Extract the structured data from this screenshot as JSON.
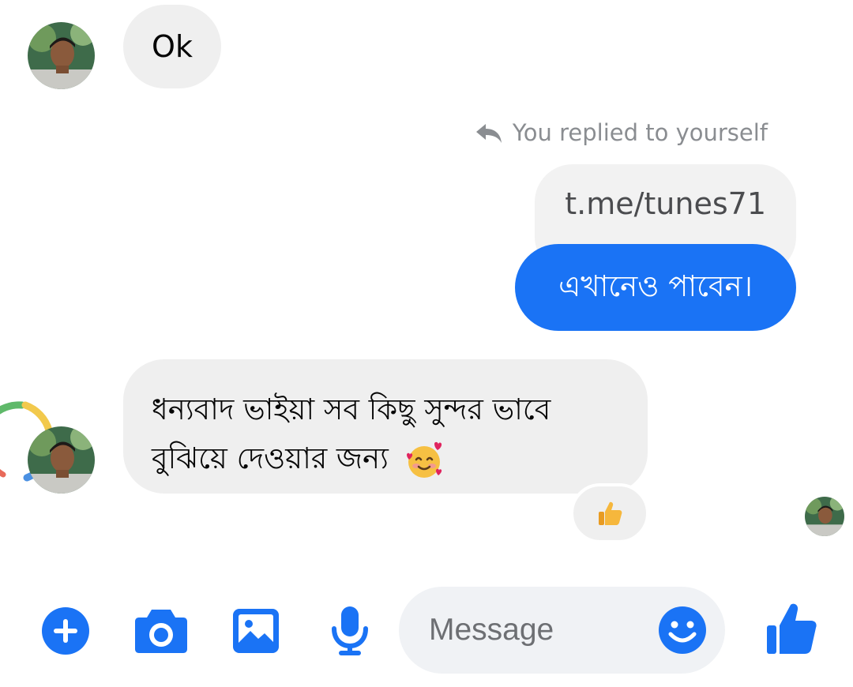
{
  "conversation": {
    "messages": [
      {
        "direction": "incoming",
        "text": "Ok"
      },
      {
        "direction": "outgoing",
        "reply_label": "You replied to yourself",
        "quoted_text": "t.me/tunes71",
        "text": "এখানেও পাবেন।"
      },
      {
        "direction": "incoming",
        "text_line1": "ধন্যবাদ ভাইয়া সব কিছু সুন্দর ভাবে",
        "text_line2": "বুঝিয়ে দেওয়ার জন্য",
        "emoji": "smiling-face-with-hearts",
        "reaction": "thumbs-up"
      }
    ]
  },
  "composer": {
    "placeholder": "Message",
    "buttons": [
      "plus-icon",
      "camera-icon",
      "image-icon",
      "microphone-icon",
      "emoji-icon",
      "like-icon"
    ]
  },
  "colors": {
    "accent": "#1a73f5",
    "incoming_bubble": "#efefef",
    "muted_text": "#8a8d91"
  }
}
